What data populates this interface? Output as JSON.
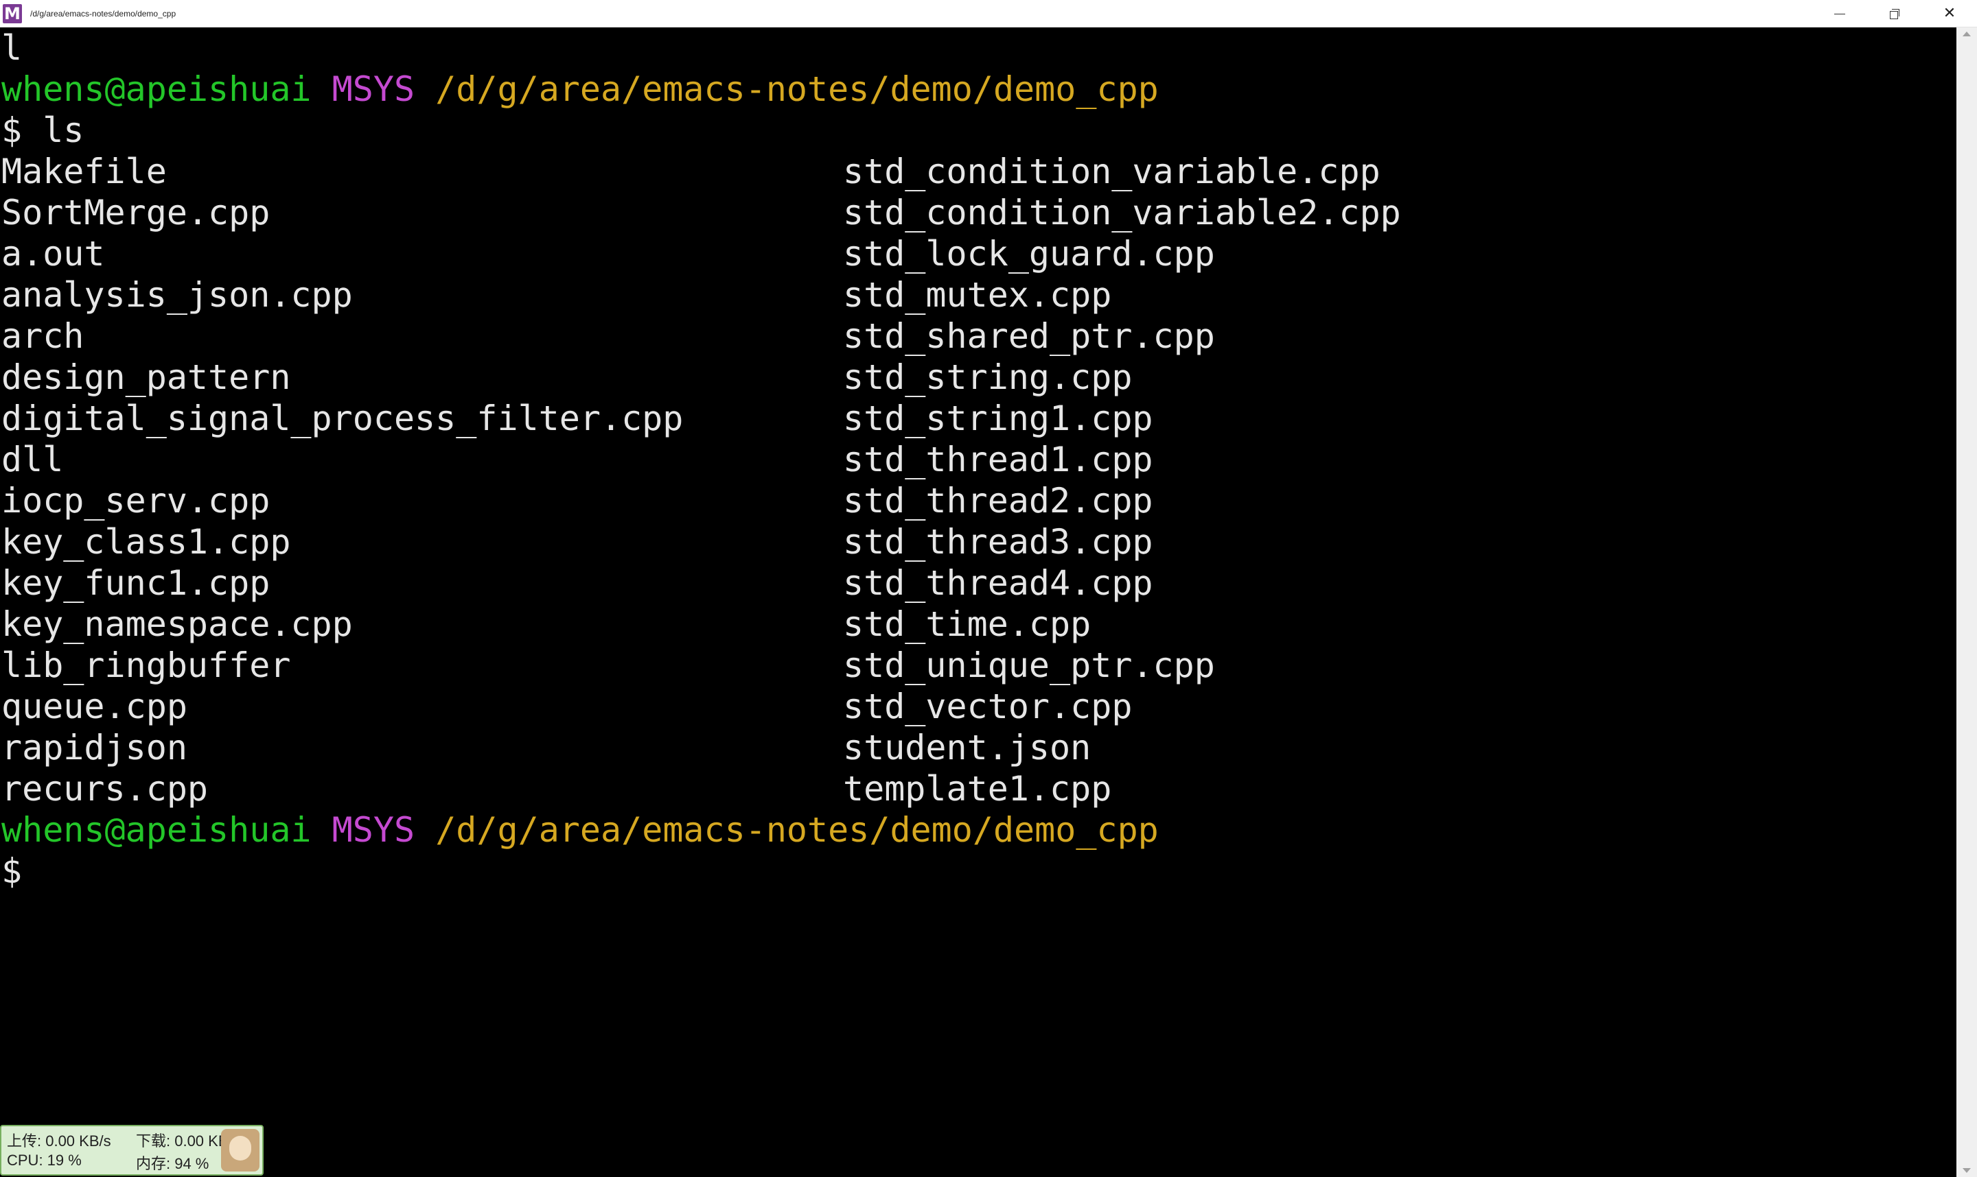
{
  "window": {
    "title": "/d/g/area/emacs-notes/demo/demo_cpp",
    "app_icon_letter": "M",
    "controls": {
      "minimize": "minimize",
      "restore": "restore",
      "close": "✕"
    }
  },
  "terminal": {
    "first_line": "l",
    "prompt1": {
      "user": "whens@apeishuai",
      "system": "MSYS",
      "path": "/d/g/area/emacs-notes/demo/demo_cpp",
      "command": "$ ls"
    },
    "listing": {
      "col1": [
        "Makefile",
        "SortMerge.cpp",
        "a.out",
        "analysis_json.cpp",
        "arch",
        "design_pattern",
        "digital_signal_process_filter.cpp",
        "dll",
        "iocp_serv.cpp",
        "key_class1.cpp",
        "key_func1.cpp",
        "key_namespace.cpp",
        "lib_ringbuffer",
        "queue.cpp",
        "rapidjson",
        "recurs.cpp"
      ],
      "col2": [
        "std_condition_variable.cpp",
        "std_condition_variable2.cpp",
        "std_lock_guard.cpp",
        "std_mutex.cpp",
        "std_shared_ptr.cpp",
        "std_string.cpp",
        "std_string1.cpp",
        "std_thread1.cpp",
        "std_thread2.cpp",
        "std_thread3.cpp",
        "std_thread4.cpp",
        "std_time.cpp",
        "std_unique_ptr.cpp",
        "std_vector.cpp",
        "student.json",
        "template1.cpp"
      ]
    },
    "prompt2": {
      "user": "whens@apeishuai",
      "system": "MSYS",
      "path": "/d/g/area/emacs-notes/demo/demo_cpp",
      "command": "$"
    }
  },
  "netmon": {
    "upload_label": "上传: 0.00 KB/s",
    "download_label": "下载: 0.00 KB/s",
    "cpu_label": "CPU: 19 %",
    "mem_label": "内存: 94 %"
  },
  "colors": {
    "user": "#23c629",
    "system": "#c54ad1",
    "path": "#d6a821",
    "text": "#e6e6e6",
    "background": "#000000"
  }
}
